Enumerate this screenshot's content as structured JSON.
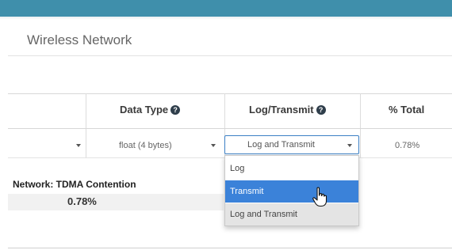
{
  "panel": {
    "title": "Wireless Network"
  },
  "table": {
    "columns": [
      {
        "label": "Data Type",
        "help_icon": "question-circle-icon"
      },
      {
        "label": "Log/Transmit",
        "help_icon": "question-circle-icon"
      },
      {
        "label": "% Total"
      }
    ],
    "row": {
      "data_type": "float (4 bytes)",
      "log_transmit": "Log and Transmit",
      "percent_total": "0.78%"
    }
  },
  "dropdown": {
    "options": [
      "Log",
      "Transmit",
      "Log and Transmit"
    ],
    "hovered": "Transmit",
    "selected": "Log and Transmit"
  },
  "network": {
    "label": "Network: TDMA Contention",
    "value": "0.78%"
  },
  "colors": {
    "topbar": "#3f8fab",
    "select_border": "#3b7fc4",
    "option_hover": "#3b82d9"
  }
}
